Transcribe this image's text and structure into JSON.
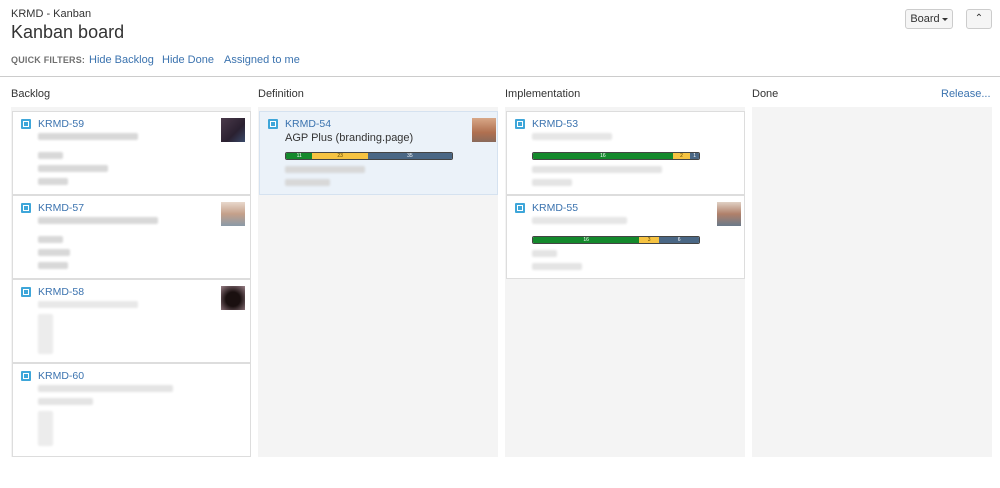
{
  "header": {
    "breadcrumb": "KRMD - Kanban",
    "title": "Kanban board",
    "quick_filters_label": "QUICK FILTERS:",
    "filters": [
      "Hide Backlog",
      "Hide Done",
      "Assigned to me"
    ],
    "board_button": "Board",
    "collapse_icon": "double-chevron-up-icon"
  },
  "columns": [
    {
      "name": "Backlog"
    },
    {
      "name": "Definition"
    },
    {
      "name": "Implementation"
    },
    {
      "name": "Done",
      "action": "Release..."
    }
  ],
  "cards": {
    "krmd59": {
      "key": "KRMD-59"
    },
    "krmd57": {
      "key": "KRMD-57"
    },
    "krmd58": {
      "key": "KRMD-58"
    },
    "krmd60": {
      "key": "KRMD-60"
    },
    "krmd54": {
      "key": "KRMD-54",
      "summary": "AGP Plus (branding.page)",
      "progress": {
        "done": 11,
        "in_progress": 23,
        "todo": 35
      }
    },
    "krmd53": {
      "key": "KRMD-53",
      "progress": {
        "done": 16,
        "in_progress": 2,
        "todo": 1
      }
    },
    "krmd55": {
      "key": "KRMD-55",
      "progress": {
        "done": 16,
        "in_progress": 3,
        "todo": 6
      }
    }
  },
  "colors": {
    "link": "#3b73af",
    "done": "#14892c",
    "in_progress": "#f6c342",
    "todo": "#4a6785",
    "story_icon": "#3ea6d9"
  }
}
